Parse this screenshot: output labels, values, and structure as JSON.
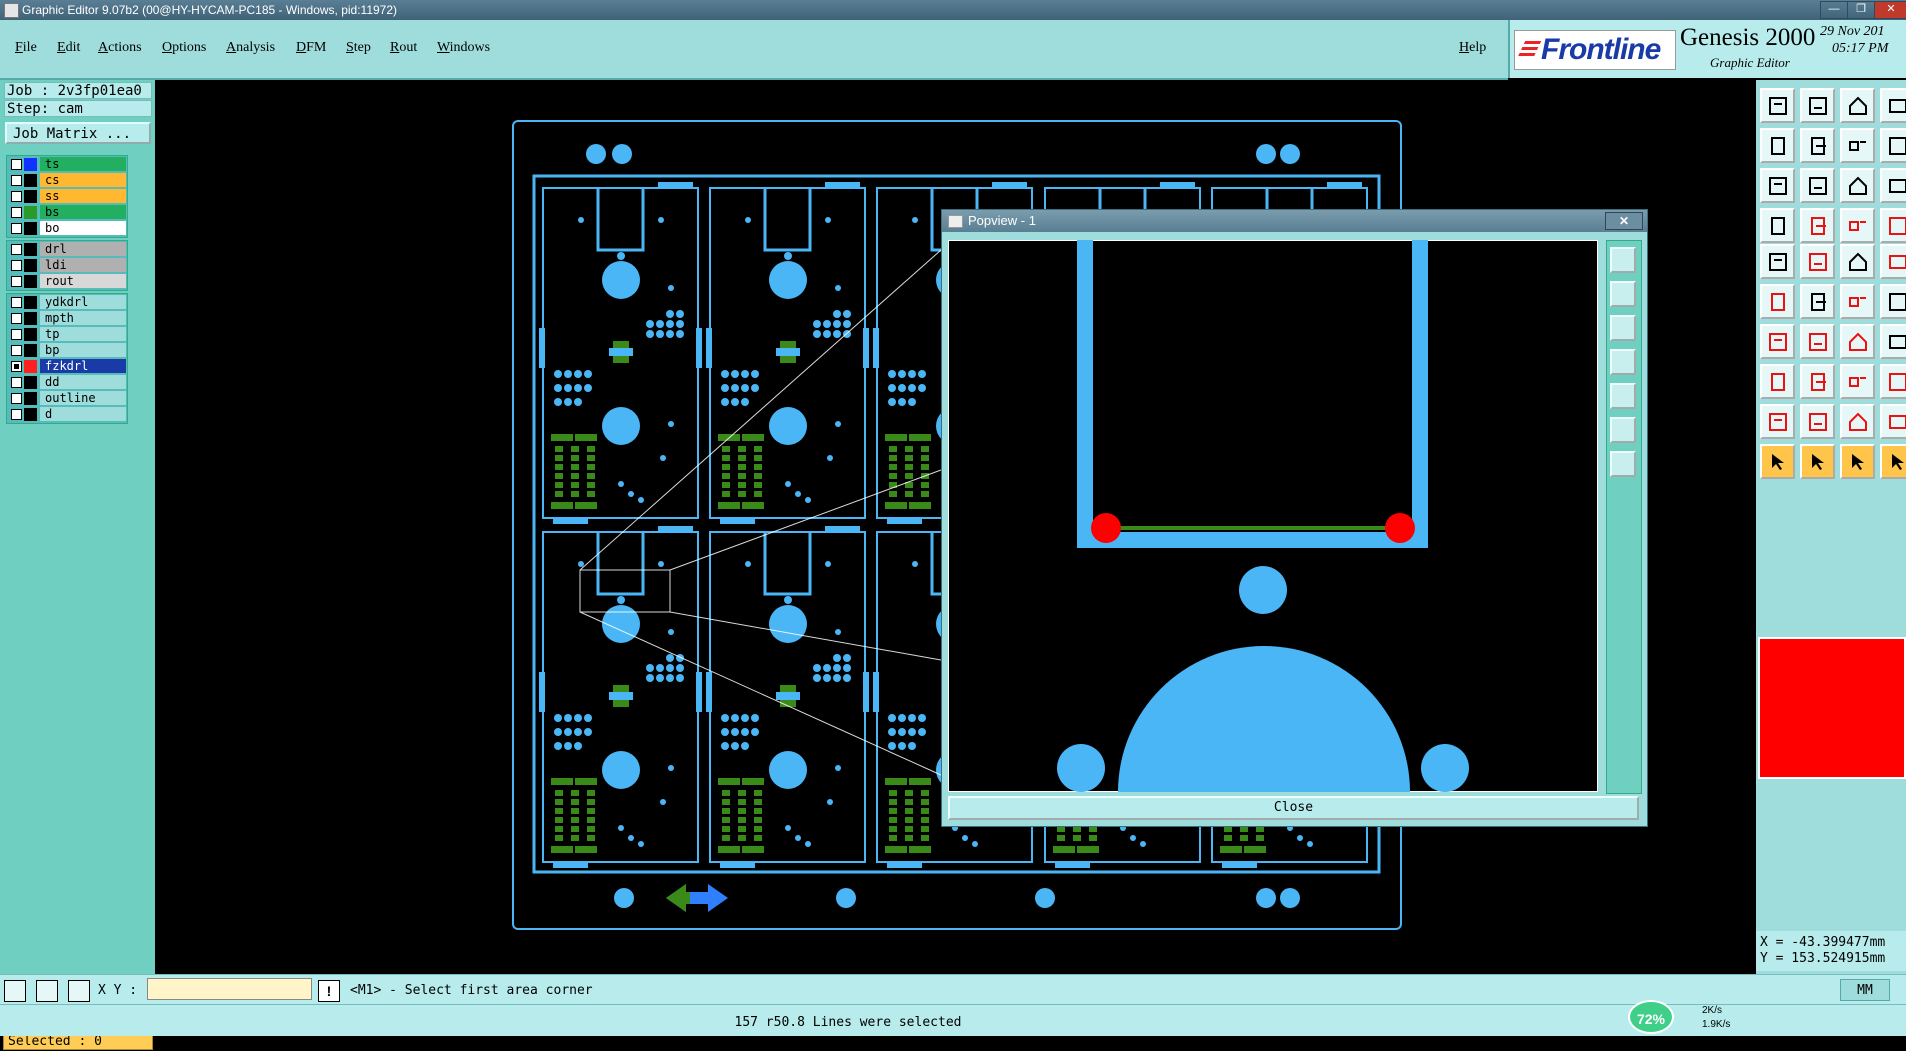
{
  "window": {
    "title": "Graphic Editor 9.07b2 (00@HY-HYCAM-PC185 - Windows, pid:11972)",
    "minimize_label": "—",
    "maximize_label": "❐",
    "close_label": "✕"
  },
  "menu": {
    "file": "File",
    "edit": "Edit",
    "actions": "Actions",
    "options": "Options",
    "analysis": "Analysis",
    "dfm": "DFM",
    "step": "Step",
    "rout": "Rout",
    "windows": "Windows",
    "help": "Help"
  },
  "brand": {
    "logo": "Frontline",
    "product": "Genesis 2000",
    "subtitle": "Graphic Editor",
    "date": "29 Nov 201",
    "time": "05:17 PM"
  },
  "job": {
    "job_line": "Job : 2v3fp01ea0",
    "step_line": "Step: cam",
    "matrix_button": "Job Matrix ..."
  },
  "layers": {
    "group1": [
      {
        "name": "ts",
        "color": "#1133ff",
        "bg": "#22b060",
        "checked": false
      },
      {
        "name": "cs",
        "color": "#000000",
        "bg": "#ffb830",
        "checked": false
      },
      {
        "name": "ss",
        "color": "#000000",
        "bg": "#ffb830",
        "checked": false
      },
      {
        "name": "bs",
        "color": "#2a9a2a",
        "bg": "#22b060",
        "checked": false
      },
      {
        "name": "bo",
        "color": "#000000",
        "bg": "#ffffff",
        "checked": false
      }
    ],
    "group2": [
      {
        "name": "drl",
        "color": "#000000",
        "bg": "#b0b0b0",
        "checked": false
      },
      {
        "name": "ldi",
        "color": "#000000",
        "bg": "#b0b0b0",
        "checked": false
      },
      {
        "name": "rout",
        "color": "#000000",
        "bg": "#d8d8d8",
        "checked": false
      }
    ],
    "group3": [
      {
        "name": "ydkdrl",
        "color": "#000000",
        "bg": "#9fdcdc",
        "checked": false
      },
      {
        "name": "mpth",
        "color": "#000000",
        "bg": "#9fdcdc",
        "checked": false
      },
      {
        "name": "tp",
        "color": "#000000",
        "bg": "#9fdcdc",
        "checked": false
      },
      {
        "name": "bp",
        "color": "#000000",
        "bg": "#9fdcdc",
        "checked": false
      },
      {
        "name": "fzkdrl",
        "color": "#ff2020",
        "bg": "#1a3aa8",
        "checked": true
      },
      {
        "name": "dd",
        "color": "#000000",
        "bg": "#9fdcdc",
        "checked": false
      },
      {
        "name": "outline",
        "color": "#000000",
        "bg": "#9fdcdc",
        "checked": false
      },
      {
        "name": "d",
        "color": "#000000",
        "bg": "#9fdcdc",
        "checked": false
      }
    ]
  },
  "selected": "Selected : 0",
  "popview": {
    "title": "Popview - 1",
    "close_x": "✕",
    "close_button": "Close"
  },
  "coords": {
    "x": "X = -43.399477mm",
    "y": "Y = 153.524915mm"
  },
  "command": {
    "xy_label": "X Y :",
    "xy_value": "",
    "alert": "!",
    "prompt": "<M1> - Select first area corner",
    "units": "MM"
  },
  "status": {
    "message": "157 r50.8 Lines were selected"
  },
  "tray": {
    "percent": "72%",
    "up": "2K/s",
    "down": "1.9K/s"
  },
  "colors": {
    "feature": "#4bb6f5",
    "pad_green": "#3a8a1a",
    "highlight_red": "#ff0000",
    "panel": "#9fdcdc",
    "panel_dark": "#6fcfc0"
  }
}
